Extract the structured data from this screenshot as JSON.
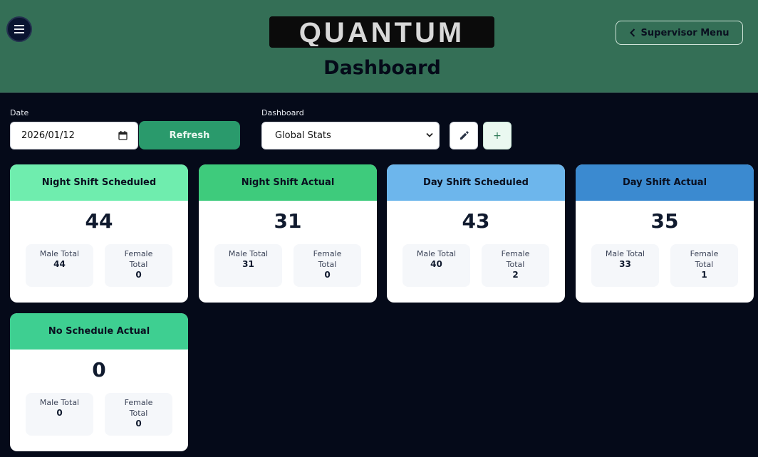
{
  "header": {
    "logo_text": "QUANTUM",
    "title": "Dashboard",
    "supervisor_menu_label": "Supervisor Menu"
  },
  "controls": {
    "date_label": "Date",
    "date_value": "2026/01/12",
    "refresh_label": "Refresh",
    "dashboard_label": "Dashboard",
    "dashboard_selected": "Global Stats",
    "add_label": "+"
  },
  "cards": [
    {
      "title": "Night Shift Scheduled",
      "total": "44",
      "male_label": "Male Total",
      "male": "44",
      "female_label": "Female Total",
      "female": "0",
      "color": "#6fedae"
    },
    {
      "title": "Night Shift Actual",
      "total": "31",
      "male_label": "Male Total",
      "male": "31",
      "female_label": "Female Total",
      "female": "0",
      "color": "#3ecb7c"
    },
    {
      "title": "Day Shift Scheduled",
      "total": "43",
      "male_label": "Male Total",
      "male": "40",
      "female_label": "Female Total",
      "female": "2",
      "color": "#6db6ec"
    },
    {
      "title": "Day Shift Actual",
      "total": "35",
      "male_label": "Male Total",
      "male": "33",
      "female_label": "Female Total",
      "female": "1",
      "color": "#3b8ad0"
    },
    {
      "title": "No Schedule Actual",
      "total": "0",
      "male_label": "Male Total",
      "male": "0",
      "female_label": "Female Total",
      "female": "0",
      "color": "#3ecf91"
    }
  ],
  "icons": {
    "menu": "hamburger-icon",
    "back": "chevron-left-icon",
    "calendar": "calendar-icon",
    "dropdown": "chevron-down-icon",
    "edit": "pencil-icon",
    "add": "plus-icon"
  }
}
